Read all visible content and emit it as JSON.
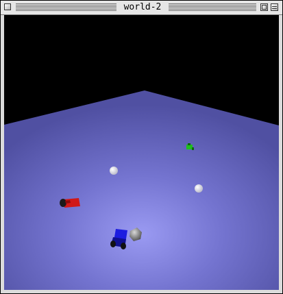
{
  "window": {
    "title": "world-2"
  },
  "scene": {
    "objects": [
      {
        "name": "green-robot",
        "color": "#1fbf1f"
      },
      {
        "name": "red-robot",
        "color": "#d01818"
      },
      {
        "name": "blue-robot",
        "color": "#1c1ce0"
      },
      {
        "name": "white-ball-1",
        "color": "#ffffff"
      },
      {
        "name": "white-ball-2",
        "color": "#ffffff"
      },
      {
        "name": "grey-rock",
        "color": "#8a8a8a"
      }
    ],
    "colors": {
      "sky": "#000000",
      "floor": "#6a6ac8"
    }
  }
}
